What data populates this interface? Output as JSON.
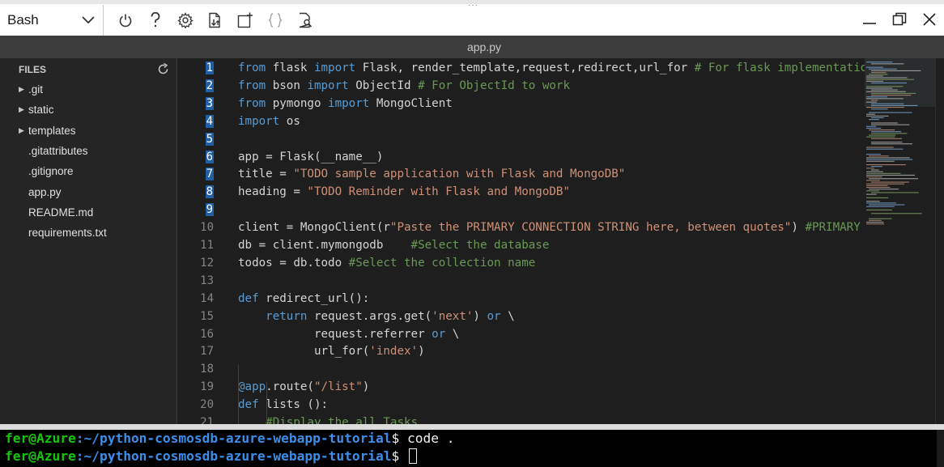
{
  "toolbar": {
    "shell_label": "Bash",
    "icons": [
      "power-icon",
      "help-icon",
      "gear-icon",
      "upload-download-icon",
      "new-session-icon",
      "braces-icon",
      "web-preview-icon"
    ],
    "window": [
      "minimize-icon",
      "restore-icon",
      "close-icon"
    ]
  },
  "tab": {
    "title": "app.py"
  },
  "sidebar": {
    "header": "FILES",
    "items": [
      {
        "name": ".git",
        "folder": true
      },
      {
        "name": "static",
        "folder": true
      },
      {
        "name": "templates",
        "folder": true
      },
      {
        "name": ".gitattributes",
        "folder": false
      },
      {
        "name": ".gitignore",
        "folder": false
      },
      {
        "name": "app.py",
        "folder": false
      },
      {
        "name": "README.md",
        "folder": false
      },
      {
        "name": "requirements.txt",
        "folder": false
      }
    ]
  },
  "editor": {
    "lines": [
      {
        "n": "1",
        "sel": true,
        "tokens": [
          [
            "kw",
            "from"
          ],
          [
            "t",
            " flask "
          ],
          [
            "kw",
            "import"
          ],
          [
            "t",
            " Flask, render_template,request,redirect,url_for "
          ],
          [
            "cm",
            "# For flask implementation"
          ]
        ]
      },
      {
        "n": "2",
        "sel": true,
        "tokens": [
          [
            "kw",
            "from"
          ],
          [
            "t",
            " bson "
          ],
          [
            "kw",
            "import"
          ],
          [
            "t",
            " ObjectId "
          ],
          [
            "cm",
            "# For ObjectId to work"
          ]
        ]
      },
      {
        "n": "3",
        "sel": true,
        "tokens": [
          [
            "kw",
            "from"
          ],
          [
            "t",
            " pymongo "
          ],
          [
            "kw",
            "import"
          ],
          [
            "t",
            " MongoClient"
          ]
        ]
      },
      {
        "n": "4",
        "sel": true,
        "tokens": [
          [
            "kw",
            "import"
          ],
          [
            "t",
            " os"
          ]
        ]
      },
      {
        "n": "5",
        "sel": true,
        "tokens": []
      },
      {
        "n": "6",
        "sel": true,
        "tokens": [
          [
            "t",
            "app = Flask(__name__)"
          ]
        ]
      },
      {
        "n": "7",
        "sel": true,
        "tokens": [
          [
            "t",
            "title = "
          ],
          [
            "str",
            "\"TODO sample application with Flask and MongoDB\""
          ]
        ]
      },
      {
        "n": "8",
        "sel": true,
        "tokens": [
          [
            "t",
            "heading = "
          ],
          [
            "str",
            "\"TODO Reminder with Flask and MongoDB\""
          ]
        ]
      },
      {
        "n": "9",
        "sel": true,
        "tokens": []
      },
      {
        "n": "10",
        "sel": false,
        "tokens": [
          [
            "t",
            "client = MongoClient(r"
          ],
          [
            "str",
            "\"Paste the PRIMARY CONNECTION STRING here, between quotes\""
          ],
          [
            "t",
            ") "
          ],
          [
            "cm",
            "#PRIMARY"
          ]
        ]
      },
      {
        "n": "11",
        "sel": false,
        "tokens": [
          [
            "t",
            "db = client.mymongodb    "
          ],
          [
            "cm",
            "#Select the database"
          ]
        ]
      },
      {
        "n": "12",
        "sel": false,
        "tokens": [
          [
            "t",
            "todos = db.todo "
          ],
          [
            "cm",
            "#Select the collection name"
          ]
        ]
      },
      {
        "n": "13",
        "sel": false,
        "tokens": []
      },
      {
        "n": "14",
        "sel": false,
        "tokens": [
          [
            "kw",
            "def"
          ],
          [
            "t",
            " redirect_url():"
          ]
        ]
      },
      {
        "n": "15",
        "sel": false,
        "tokens": [
          [
            "t",
            "    "
          ],
          [
            "kw",
            "return"
          ],
          [
            "t",
            " request.args.get("
          ],
          [
            "str",
            "'next'"
          ],
          [
            "t",
            ") "
          ],
          [
            "kw",
            "or"
          ],
          [
            "t",
            " \\"
          ]
        ]
      },
      {
        "n": "16",
        "sel": false,
        "tokens": [
          [
            "t",
            "           request.referrer "
          ],
          [
            "kw",
            "or"
          ],
          [
            "t",
            " \\"
          ]
        ]
      },
      {
        "n": "17",
        "sel": false,
        "tokens": [
          [
            "t",
            "           url_for("
          ],
          [
            "str",
            "'index'"
          ],
          [
            "t",
            ")"
          ]
        ]
      },
      {
        "n": "18",
        "sel": false,
        "tokens": []
      },
      {
        "n": "19",
        "sel": false,
        "tokens": [
          [
            "kw",
            "@app"
          ],
          [
            "t",
            ".route("
          ],
          [
            "str",
            "\"/list\""
          ],
          [
            "t",
            ")"
          ]
        ]
      },
      {
        "n": "20",
        "sel": false,
        "tokens": [
          [
            "kw",
            "def"
          ],
          [
            "t",
            " lists ():"
          ]
        ]
      },
      {
        "n": "21",
        "sel": false,
        "tokens": [
          [
            "t",
            "    "
          ],
          [
            "cm",
            "#Display the all Tasks"
          ]
        ]
      }
    ]
  },
  "terminal": {
    "lines": [
      {
        "user": "fer@Azure",
        "path": ":~/python-cosmosdb-azure-webapp-tutorial",
        "prompt": "$ ",
        "cmd": "code .",
        "cursor": false
      },
      {
        "user": "fer@Azure",
        "path": ":~/python-cosmosdb-azure-webapp-tutorial",
        "prompt": "$ ",
        "cmd": "",
        "cursor": true
      }
    ]
  },
  "colors": {
    "keyword": "#569cd6",
    "string": "#ce9178",
    "comment": "#6a9955",
    "selection": "#1f5fa6",
    "terminal_user": "#16c60c",
    "terminal_path": "#3b8eea"
  }
}
